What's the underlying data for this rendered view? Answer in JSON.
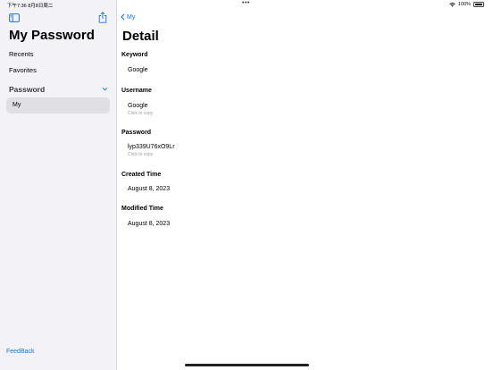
{
  "status": {
    "time": "下午7:36  8月8日周二",
    "battery": "100%"
  },
  "sidebar": {
    "title": "My Password",
    "recents": "Recents",
    "favorites": "Favorites",
    "section": "Password",
    "items": [
      {
        "label": "My"
      }
    ],
    "feedback": "FeedBack"
  },
  "detail": {
    "back_label": "My",
    "title": "Detail",
    "fields": [
      {
        "label": "Keyword",
        "value": "Google"
      },
      {
        "label": "Username",
        "value": "Google",
        "hint": "Click to copy"
      },
      {
        "label": "Password",
        "value": "lyp339U76xO9Lr",
        "hint": "Click to copy"
      },
      {
        "label": "Created Time",
        "value": "August 8, 2023"
      },
      {
        "label": "Modified Time",
        "value": "August 8, 2023"
      }
    ]
  },
  "colors": {
    "accent": "#1a74e8",
    "sidebar_bg": "#f2f2f7",
    "selected_bg": "#dfdfe4"
  }
}
